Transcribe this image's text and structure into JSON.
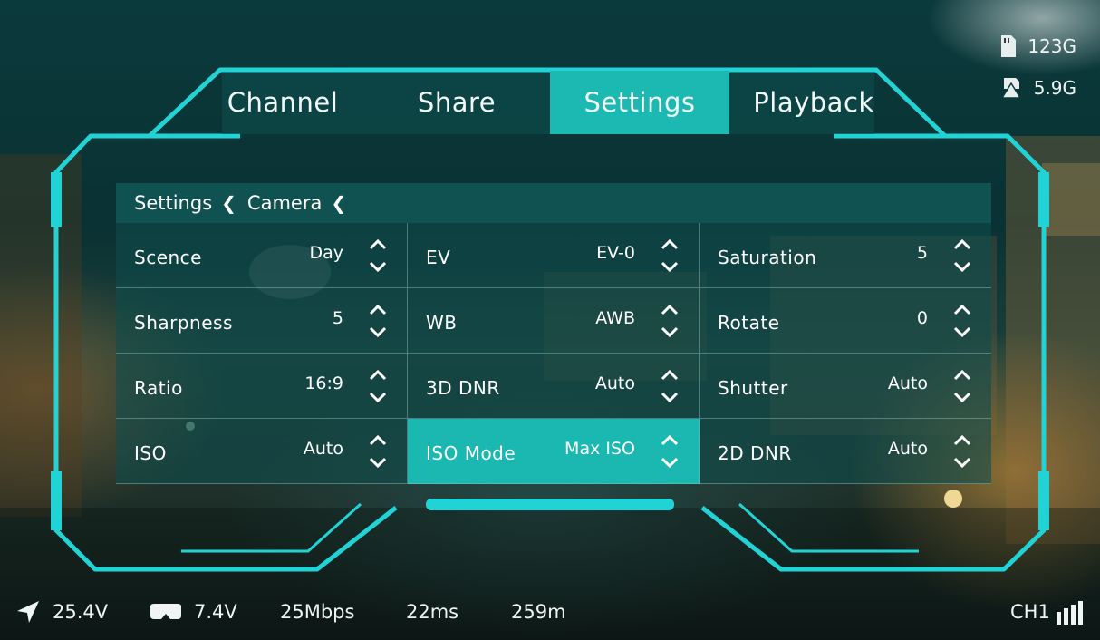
{
  "tabs": [
    {
      "label": "Channel"
    },
    {
      "label": "Share"
    },
    {
      "label": "Settings"
    },
    {
      "label": "Playback"
    }
  ],
  "active_tab": "Settings",
  "breadcrumb": [
    {
      "label": "Settings"
    },
    {
      "label": "Camera"
    }
  ],
  "settings": [
    {
      "label": "Scence",
      "value": "Day"
    },
    {
      "label": "EV",
      "value": "EV-0"
    },
    {
      "label": "Saturation",
      "value": "5"
    },
    {
      "label": "Sharpness",
      "value": "5"
    },
    {
      "label": "WB",
      "value": "AWB"
    },
    {
      "label": "Rotate",
      "value": "0"
    },
    {
      "label": "Ratio",
      "value": "16:9"
    },
    {
      "label": "3D DNR",
      "value": "Auto"
    },
    {
      "label": "Shutter",
      "value": "Auto"
    },
    {
      "label": "ISO",
      "value": "Auto"
    },
    {
      "label": "ISO Mode",
      "value": "Max ISO"
    },
    {
      "label": "2D DNR",
      "value": "Auto"
    }
  ],
  "storage": {
    "sd_card": "123G",
    "remaining": "5.9G"
  },
  "status_bar": {
    "aircraft_voltage": "25.4V",
    "goggles_voltage": "7.4V",
    "bitrate": "25Mbps",
    "latency": "22ms",
    "distance": "259m",
    "channel": "CH1"
  },
  "colors": {
    "accent": "#1bb9b2",
    "frame": "#22d3d6"
  },
  "icons": [
    "sd-card-icon",
    "storage-icon",
    "aircraft-icon",
    "goggles-icon",
    "signal-bars-icon",
    "chevron-left-icon",
    "up-down-arrows-icon"
  ]
}
